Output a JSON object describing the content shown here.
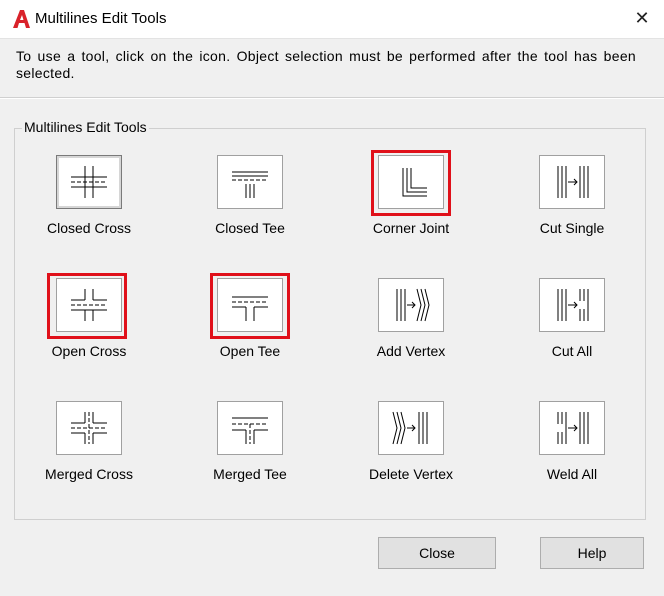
{
  "window": {
    "title": "Multilines Edit Tools",
    "icon": "autocad-a-icon"
  },
  "instructions": "To use a tool, click on the icon.  Object selection must be performed after the tool has been selected.",
  "group_label": "Multilines Edit Tools",
  "tools": [
    {
      "label": "Closed Cross",
      "icon": "closed-cross-icon"
    },
    {
      "label": "Closed Tee",
      "icon": "closed-tee-icon"
    },
    {
      "label": "Corner Joint",
      "icon": "corner-joint-icon"
    },
    {
      "label": "Cut Single",
      "icon": "cut-single-icon"
    },
    {
      "label": "Open Cross",
      "icon": "open-cross-icon"
    },
    {
      "label": "Open Tee",
      "icon": "open-tee-icon"
    },
    {
      "label": "Add Vertex",
      "icon": "add-vertex-icon"
    },
    {
      "label": "Cut All",
      "icon": "cut-all-icon"
    },
    {
      "label": "Merged Cross",
      "icon": "merged-cross-icon"
    },
    {
      "label": "Merged Tee",
      "icon": "merged-tee-icon"
    },
    {
      "label": "Delete Vertex",
      "icon": "delete-vertex-icon"
    },
    {
      "label": "Weld All",
      "icon": "weld-all-icon"
    }
  ],
  "highlighted_tools": [
    "Corner Joint",
    "Open Cross",
    "Open Tee"
  ],
  "highlight_color": "#e0101a",
  "buttons": {
    "close": "Close",
    "help": "Help"
  }
}
